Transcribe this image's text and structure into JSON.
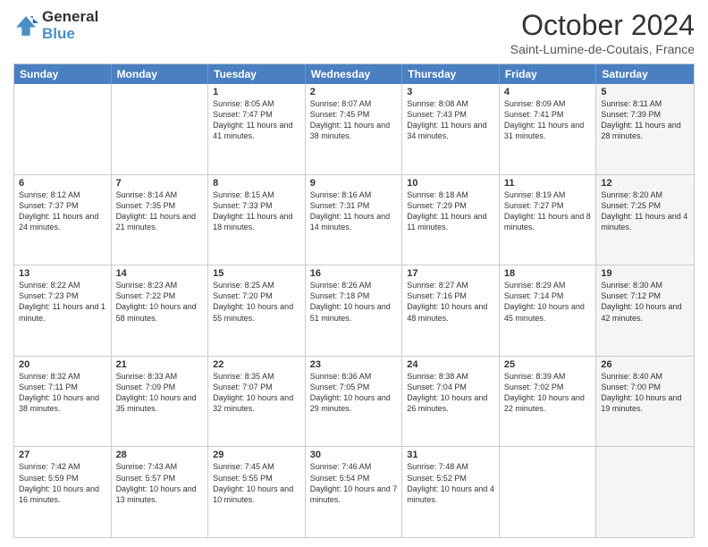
{
  "header": {
    "logo_line1": "General",
    "logo_line2": "Blue",
    "month": "October 2024",
    "location": "Saint-Lumine-de-Coutais, France"
  },
  "weekdays": [
    "Sunday",
    "Monday",
    "Tuesday",
    "Wednesday",
    "Thursday",
    "Friday",
    "Saturday"
  ],
  "rows": [
    [
      {
        "day": "",
        "text": "",
        "shade": false
      },
      {
        "day": "",
        "text": "",
        "shade": false
      },
      {
        "day": "1",
        "text": "Sunrise: 8:05 AM\nSunset: 7:47 PM\nDaylight: 11 hours and 41 minutes.",
        "shade": false
      },
      {
        "day": "2",
        "text": "Sunrise: 8:07 AM\nSunset: 7:45 PM\nDaylight: 11 hours and 38 minutes.",
        "shade": false
      },
      {
        "day": "3",
        "text": "Sunrise: 8:08 AM\nSunset: 7:43 PM\nDaylight: 11 hours and 34 minutes.",
        "shade": false
      },
      {
        "day": "4",
        "text": "Sunrise: 8:09 AM\nSunset: 7:41 PM\nDaylight: 11 hours and 31 minutes.",
        "shade": false
      },
      {
        "day": "5",
        "text": "Sunrise: 8:11 AM\nSunset: 7:39 PM\nDaylight: 11 hours and 28 minutes.",
        "shade": true
      }
    ],
    [
      {
        "day": "6",
        "text": "Sunrise: 8:12 AM\nSunset: 7:37 PM\nDaylight: 11 hours and 24 minutes.",
        "shade": false
      },
      {
        "day": "7",
        "text": "Sunrise: 8:14 AM\nSunset: 7:35 PM\nDaylight: 11 hours and 21 minutes.",
        "shade": false
      },
      {
        "day": "8",
        "text": "Sunrise: 8:15 AM\nSunset: 7:33 PM\nDaylight: 11 hours and 18 minutes.",
        "shade": false
      },
      {
        "day": "9",
        "text": "Sunrise: 8:16 AM\nSunset: 7:31 PM\nDaylight: 11 hours and 14 minutes.",
        "shade": false
      },
      {
        "day": "10",
        "text": "Sunrise: 8:18 AM\nSunset: 7:29 PM\nDaylight: 11 hours and 11 minutes.",
        "shade": false
      },
      {
        "day": "11",
        "text": "Sunrise: 8:19 AM\nSunset: 7:27 PM\nDaylight: 11 hours and 8 minutes.",
        "shade": false
      },
      {
        "day": "12",
        "text": "Sunrise: 8:20 AM\nSunset: 7:25 PM\nDaylight: 11 hours and 4 minutes.",
        "shade": true
      }
    ],
    [
      {
        "day": "13",
        "text": "Sunrise: 8:22 AM\nSunset: 7:23 PM\nDaylight: 11 hours and 1 minute.",
        "shade": false
      },
      {
        "day": "14",
        "text": "Sunrise: 8:23 AM\nSunset: 7:22 PM\nDaylight: 10 hours and 58 minutes.",
        "shade": false
      },
      {
        "day": "15",
        "text": "Sunrise: 8:25 AM\nSunset: 7:20 PM\nDaylight: 10 hours and 55 minutes.",
        "shade": false
      },
      {
        "day": "16",
        "text": "Sunrise: 8:26 AM\nSunset: 7:18 PM\nDaylight: 10 hours and 51 minutes.",
        "shade": false
      },
      {
        "day": "17",
        "text": "Sunrise: 8:27 AM\nSunset: 7:16 PM\nDaylight: 10 hours and 48 minutes.",
        "shade": false
      },
      {
        "day": "18",
        "text": "Sunrise: 8:29 AM\nSunset: 7:14 PM\nDaylight: 10 hours and 45 minutes.",
        "shade": false
      },
      {
        "day": "19",
        "text": "Sunrise: 8:30 AM\nSunset: 7:12 PM\nDaylight: 10 hours and 42 minutes.",
        "shade": true
      }
    ],
    [
      {
        "day": "20",
        "text": "Sunrise: 8:32 AM\nSunset: 7:11 PM\nDaylight: 10 hours and 38 minutes.",
        "shade": false
      },
      {
        "day": "21",
        "text": "Sunrise: 8:33 AM\nSunset: 7:09 PM\nDaylight: 10 hours and 35 minutes.",
        "shade": false
      },
      {
        "day": "22",
        "text": "Sunrise: 8:35 AM\nSunset: 7:07 PM\nDaylight: 10 hours and 32 minutes.",
        "shade": false
      },
      {
        "day": "23",
        "text": "Sunrise: 8:36 AM\nSunset: 7:05 PM\nDaylight: 10 hours and 29 minutes.",
        "shade": false
      },
      {
        "day": "24",
        "text": "Sunrise: 8:38 AM\nSunset: 7:04 PM\nDaylight: 10 hours and 26 minutes.",
        "shade": false
      },
      {
        "day": "25",
        "text": "Sunrise: 8:39 AM\nSunset: 7:02 PM\nDaylight: 10 hours and 22 minutes.",
        "shade": false
      },
      {
        "day": "26",
        "text": "Sunrise: 8:40 AM\nSunset: 7:00 PM\nDaylight: 10 hours and 19 minutes.",
        "shade": true
      }
    ],
    [
      {
        "day": "27",
        "text": "Sunrise: 7:42 AM\nSunset: 5:59 PM\nDaylight: 10 hours and 16 minutes.",
        "shade": false
      },
      {
        "day": "28",
        "text": "Sunrise: 7:43 AM\nSunset: 5:57 PM\nDaylight: 10 hours and 13 minutes.",
        "shade": false
      },
      {
        "day": "29",
        "text": "Sunrise: 7:45 AM\nSunset: 5:55 PM\nDaylight: 10 hours and 10 minutes.",
        "shade": false
      },
      {
        "day": "30",
        "text": "Sunrise: 7:46 AM\nSunset: 5:54 PM\nDaylight: 10 hours and 7 minutes.",
        "shade": false
      },
      {
        "day": "31",
        "text": "Sunrise: 7:48 AM\nSunset: 5:52 PM\nDaylight: 10 hours and 4 minutes.",
        "shade": false
      },
      {
        "day": "",
        "text": "",
        "shade": false
      },
      {
        "day": "",
        "text": "",
        "shade": true
      }
    ]
  ]
}
